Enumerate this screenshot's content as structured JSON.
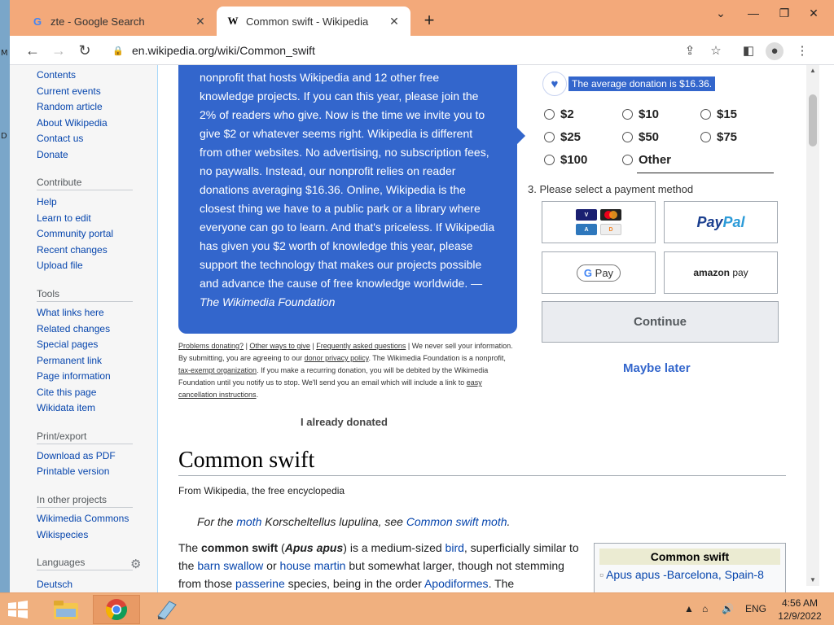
{
  "browser": {
    "tabs": [
      {
        "title": "zte - Google Search",
        "favicon": "G"
      },
      {
        "title": "Common swift - Wikipedia",
        "favicon": "W"
      }
    ],
    "url": "en.wikipedia.org/wiki/Common_swift"
  },
  "sidebar": {
    "nav": [
      "Contents",
      "Current events",
      "Random article",
      "About Wikipedia",
      "Contact us",
      "Donate"
    ],
    "contribute_heading": "Contribute",
    "contribute": [
      "Help",
      "Learn to edit",
      "Community portal",
      "Recent changes",
      "Upload file"
    ],
    "tools_heading": "Tools",
    "tools": [
      "What links here",
      "Related changes",
      "Special pages",
      "Permanent link",
      "Page information",
      "Cite this page",
      "Wikidata item"
    ],
    "print_heading": "Print/export",
    "print": [
      "Download as PDF",
      "Printable version"
    ],
    "projects_heading": "In other projects",
    "projects": [
      "Wikimedia Commons",
      "Wikispecies"
    ],
    "languages_heading": "Languages",
    "languages": [
      "Deutsch"
    ]
  },
  "banner": {
    "text": "nonprofit that hosts Wikipedia and 12 other free knowledge projects. If you can this year, please join the 2% of readers who give. Now is the time we invite you to give $2 or whatever seems right. Wikipedia is different from other websites. No advertising, no subscription fees, no paywalls. Instead, our nonprofit relies on reader donations averaging $16.36. Online, Wikipedia is the closest thing we have to a public park or a library where everyone can go to learn. And that's priceless. If Wikipedia has given you $2 worth of knowledge this year, please support the technology that makes our projects possible and advance the cause of free knowledge worldwide. —",
    "signature": "The Wikimedia Foundation",
    "fine": {
      "problems": "Problems donating?",
      "other_ways": "Other ways to give",
      "faq": "Frequently asked questions",
      "t1": " | We never sell your information. By submitting, you are agreeing to our ",
      "privacy": "donor privacy policy",
      "t2": ". The Wikimedia Foundation is a nonprofit, ",
      "tax": "tax-exempt organization",
      "t3": ". If you make a recurring donation, you will be debited by the Wikimedia Foundation until you notify us to stop. We'll send you an email which will include a link to ",
      "cancel": "easy cancellation instructions",
      "t4": "."
    },
    "already_donated": "I already donated"
  },
  "donation": {
    "average": "The average donation is $16.36.",
    "amounts": [
      "$2",
      "$10",
      "$15",
      "$25",
      "$50",
      "$75",
      "$100",
      "Other"
    ],
    "payment_label": "3. Please select a payment method",
    "continue": "Continue",
    "maybe_later": "Maybe later"
  },
  "article": {
    "title": "Common swift",
    "subtitle": "From Wikipedia, the free encyclopedia",
    "hat_pre": "For the ",
    "hat_moth": "moth",
    "hat_mid": " Korscheltellus lupulina, see ",
    "hat_link": "Common swift moth",
    "hat_end": ".",
    "lead": {
      "p1": "The ",
      "b1": "common swift",
      "p2": " (",
      "b2": "Apus apus",
      "p3": ") is a medium-sized ",
      "l1": "bird",
      "p4": ", superficially similar to the ",
      "l2": "barn swallow",
      "p5": " or ",
      "l3": "house martin",
      "p6": " but somewhat larger, though not stemming from those ",
      "l4": "passerine",
      "p7": " species, being in the order ",
      "l5": "Apodiformes",
      "p8": ". The"
    },
    "infobox_title": "Common swift",
    "infobox_image": "Apus apus -Barcelona, Spain-8"
  },
  "taskbar": {
    "lang": "ENG",
    "time": "4:56 AM",
    "date": "12/9/2022"
  },
  "colors": {
    "banner": "#3366cc",
    "link": "#0645ad",
    "taskbar": "#f0b07f"
  }
}
